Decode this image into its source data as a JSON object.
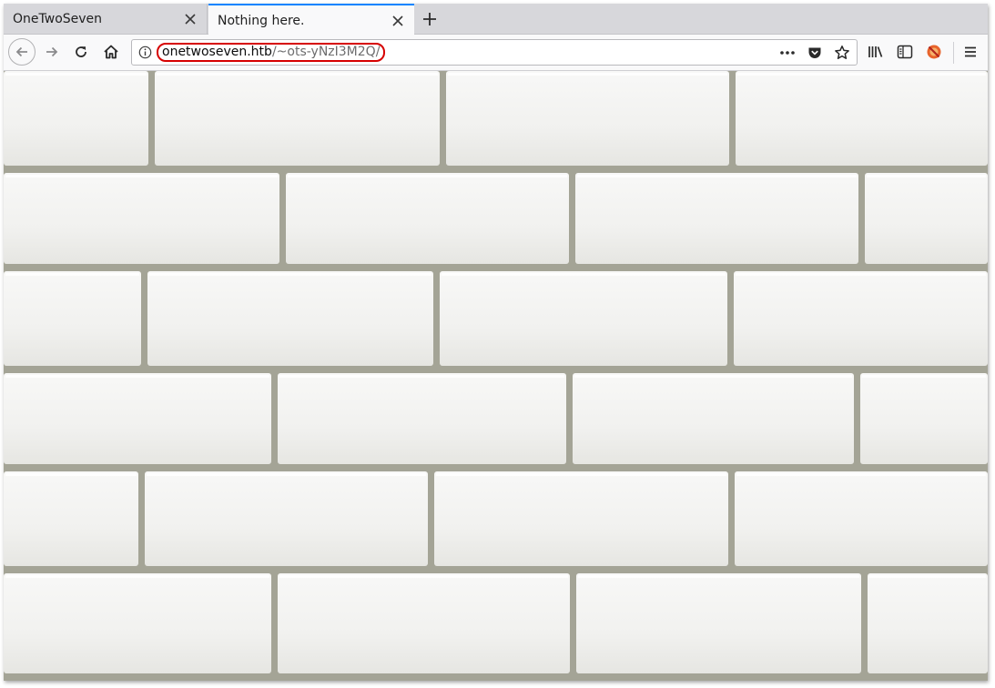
{
  "tabs": [
    {
      "title": "OneTwoSeven",
      "active": false
    },
    {
      "title": "Nothing here.",
      "active": true
    }
  ],
  "urlbar": {
    "domain": "onetwoseven.htb",
    "path": "/~ots-yNzI3M2Q/"
  },
  "icons": {
    "tab_close": "close-icon",
    "new_tab": "plus-icon",
    "back": "arrow-left-icon",
    "forward": "arrow-right-icon",
    "reload": "reload-icon",
    "home": "home-icon",
    "site_info": "info-icon",
    "page_actions": "ellipsis-icon",
    "pocket": "pocket-icon",
    "bookmark": "star-icon",
    "library": "library-icon",
    "sidebar": "sidebar-icon",
    "addon": "noscript-icon",
    "menu": "hamburger-icon"
  },
  "colors": {
    "tab_accent": "#0a84ff",
    "url_highlight_border": "#d60000",
    "wall_brick": "#f3f3f1",
    "wall_mortar": "#9a9a8c"
  },
  "content": {
    "background": "white painted brick wall"
  }
}
